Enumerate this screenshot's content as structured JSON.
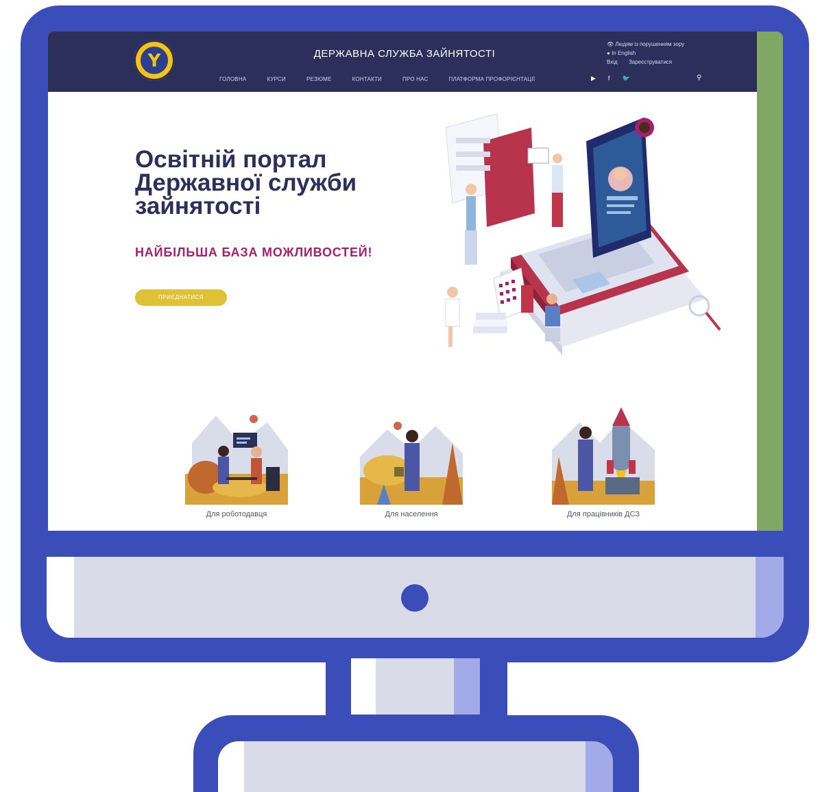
{
  "header": {
    "site_title": "ДЕРЖАВНА СЛУЖБА ЗАЙНЯТОСТІ",
    "accessibility_link": "Людям із порушенням зору",
    "english_link": "In English",
    "login_link": "Вхід",
    "register_link": "Зареєструватися",
    "nav": [
      "ГОЛОВНА",
      "КУРСИ",
      "РЕЗЮМЕ",
      "КОНТАКТИ",
      "ПРО НАС",
      "ПЛАТФОРМА ПРОФОРІЄНТАЦІЇ"
    ],
    "social_icons": [
      "youtube-icon",
      "facebook-icon",
      "twitter-icon"
    ]
  },
  "hero": {
    "title_line1": "Освітній портал",
    "title_line2": "Державної служби",
    "title_line3": "зайнятості",
    "tagline": "НАЙБІЛЬША БАЗА МОЖЛИВОСТЕЙ!",
    "button_label": "ПРИЄДНАТИСЯ"
  },
  "categories": [
    {
      "label": "Для роботодавця"
    },
    {
      "label": "Для населення"
    },
    {
      "label": "Для працівників ДСЗ"
    }
  ],
  "colors": {
    "monitor_frame": "#3a4db8",
    "header_bg": "#2c2f5a",
    "title_color": "#2c2f5a",
    "tagline_color": "#a4206e",
    "button_color": "#dfc137",
    "side_strip": "#80a764"
  }
}
